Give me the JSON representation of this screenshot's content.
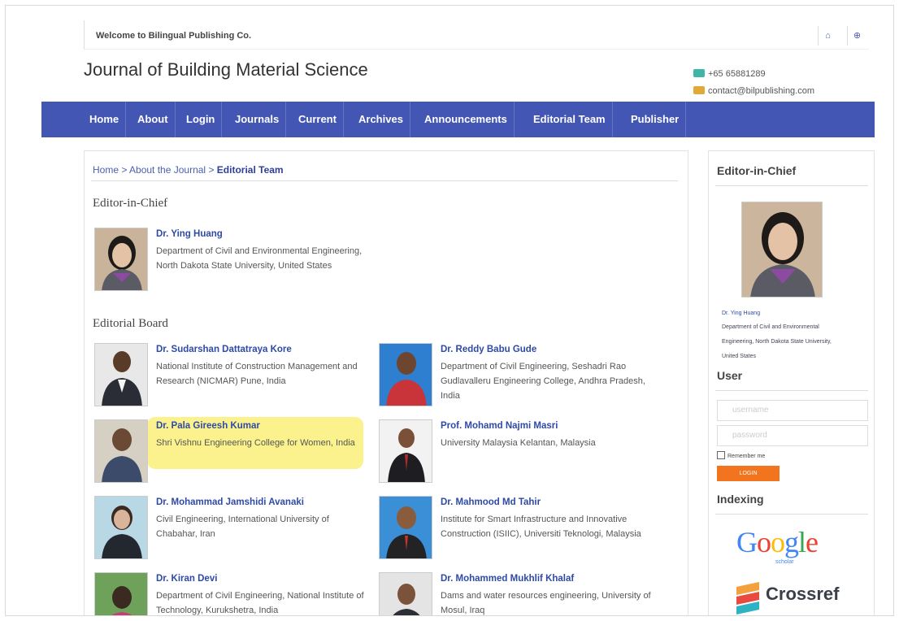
{
  "topbar": {
    "welcome": "Welcome to Bilingual Publishing Co.",
    "icons": [
      "home-icon",
      "globe-icon"
    ]
  },
  "site": {
    "title": "Journal of Building Material Science",
    "phone": "+65 65881289",
    "email": "contact@bilpublishing.com"
  },
  "nav": [
    "Home",
    "About",
    "Login",
    "Journals",
    "Current",
    "Archives",
    "Announcements",
    "Editorial Team",
    "Publisher"
  ],
  "breadcrumb": {
    "home": "Home",
    "sep": " > ",
    "about": "About the Journal",
    "current": "Editorial Team"
  },
  "sections": {
    "chief": "Editor-in-Chief",
    "board": "Editorial Board"
  },
  "chief": {
    "name": "Dr. Ying Huang",
    "affiliation": "Department of Civil and Environmental Engineering, North Dakota State University, United States"
  },
  "board": [
    {
      "name": "Dr. Sudarshan Dattatraya Kore",
      "affiliation": "National Institute of Construction Management and Research (NICMAR) Pune, India"
    },
    {
      "name": "Dr. Reddy Babu Gude",
      "affiliation": "Department of Civil Engineering, Seshadri Rao Gudlavalleru Engineering College, Andhra Pradesh, India"
    },
    {
      "name": "Dr. Pala Gireesh Kumar",
      "affiliation": "Shri Vishnu Engineering College for Women, India"
    },
    {
      "name": "Prof. Mohamd Najmi Masri",
      "affiliation": "University Malaysia Kelantan, Malaysia"
    },
    {
      "name": "Dr. Mohammad Jamshidi Avanaki",
      "affiliation": "Civil Engineering, International University of Chabahar, Iran"
    },
    {
      "name": "Dr. Mahmood Md Tahir",
      "affiliation": "Institute for Smart Infrastructure and Innovative Construction (ISIIC), Universiti Teknologi, Malaysia"
    },
    {
      "name": "Dr. Kiran Devi",
      "affiliation": "Department of Civil Engineering, National Institute of Technology, Kurukshetra, India"
    },
    {
      "name": "Dr. Mohammed Mukhlif Khalaf",
      "affiliation": "Dams and water resources engineering, University of Mosul, Iraq"
    }
  ],
  "sidebar": {
    "chief_title": "Editor-in-Chief",
    "chief_name": "Dr. Ying Huang",
    "chief_aff1": "Department of Civil and Environmental",
    "chief_aff2": "Engineering, North Dakota State University,",
    "chief_aff3": "United States",
    "user_title": "User",
    "username_placeholder": "username",
    "password_placeholder": "password",
    "remember": "Remember me",
    "login": "LOGIN",
    "indexing_title": "Indexing",
    "google_letters": [
      "G",
      "o",
      "o",
      "g",
      "l",
      "e"
    ],
    "scholar": "scholar",
    "crossref": "Crossref"
  },
  "colors": {
    "nav": "#4456b3",
    "link": "#2e4aa8",
    "highlight": "#fbf28d",
    "login": "#f2741e"
  }
}
